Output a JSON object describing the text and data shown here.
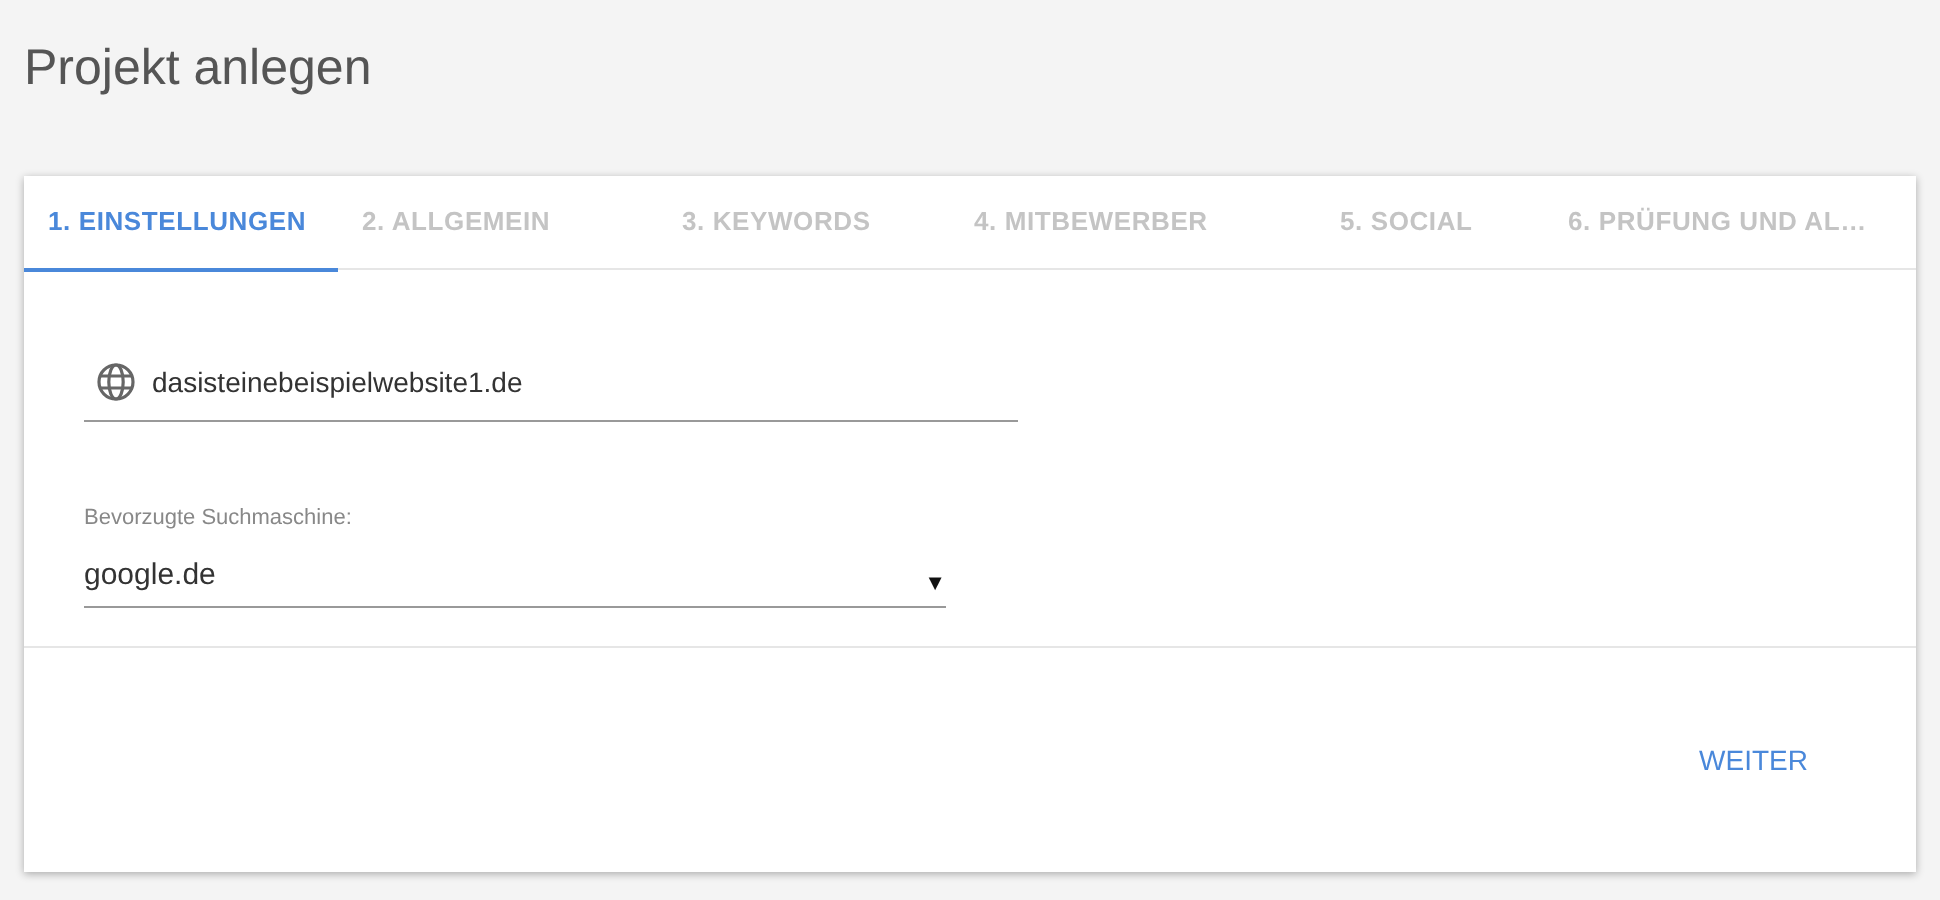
{
  "page_title": "Projekt anlegen",
  "tabs": [
    {
      "label": "1. EINSTELLUNGEN",
      "selected": true
    },
    {
      "label": "2. ALLGEMEIN",
      "selected": false
    },
    {
      "label": "3. KEYWORDS",
      "selected": false
    },
    {
      "label": "4. MITBEWERBER",
      "selected": false
    },
    {
      "label": "5. SOCIAL",
      "selected": false
    },
    {
      "label": "6. PRÜFUNG UND AL…",
      "selected": false
    }
  ],
  "website_field": {
    "value": "dasisteinebeispielwebsite1.de"
  },
  "search_engine": {
    "label": "Bevorzugte Suchmaschine:",
    "value": "google.de",
    "arrow": "▼"
  },
  "next_button": {
    "label": "WEITER"
  }
}
